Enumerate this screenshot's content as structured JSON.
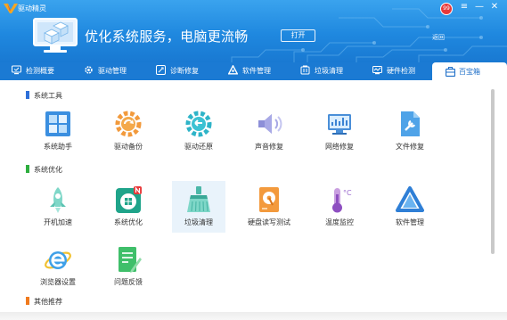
{
  "window": {
    "title": "驱动精灵",
    "badge": "99",
    "controls": [
      "≡",
      "—",
      "✕"
    ]
  },
  "header": {
    "slogan": "优化系统服务，电脑更流畅",
    "open_label": "打开",
    "return_label": "返回"
  },
  "tabs": [
    {
      "label": "检测概要",
      "icon": "monitor-check-icon"
    },
    {
      "label": "驱动管理",
      "icon": "gear-icon"
    },
    {
      "label": "诊断修复",
      "icon": "wrench-icon"
    },
    {
      "label": "软件管理",
      "icon": "triangle-app-icon"
    },
    {
      "label": "垃圾清理",
      "icon": "broom-icon"
    },
    {
      "label": "硬件检测",
      "icon": "hardware-icon"
    },
    {
      "label": "百宝箱",
      "icon": "toolbox-icon",
      "active": true
    }
  ],
  "sections": {
    "system_tools": {
      "title": "系统工具",
      "color": "#2d6fd8"
    },
    "system_optimize": {
      "title": "系统优化",
      "color": "#2eae3f"
    },
    "others": {
      "title": "其他推荐",
      "color": "#f07a1e"
    }
  },
  "tools": {
    "system_helper": "系统助手",
    "driver_backup": "驱动备份",
    "driver_restore": "驱动还原",
    "sound_repair": "声音修复",
    "network_repair": "网络修复",
    "file_repair": "文件修复",
    "boot_speedup": "开机加速",
    "system_optimize": "系统优化",
    "junk_clean": "垃圾清理",
    "disk_test": "硬盘读写测试",
    "temp_monitor": "温度监控",
    "software_manage": "软件管理",
    "browser_settings": "浏览器设置",
    "feedback": "问题反馈"
  },
  "colors": {
    "header_blue": "#1f88df",
    "tab_blue": "#1b7ad3",
    "accent": "#1f6fc8"
  }
}
